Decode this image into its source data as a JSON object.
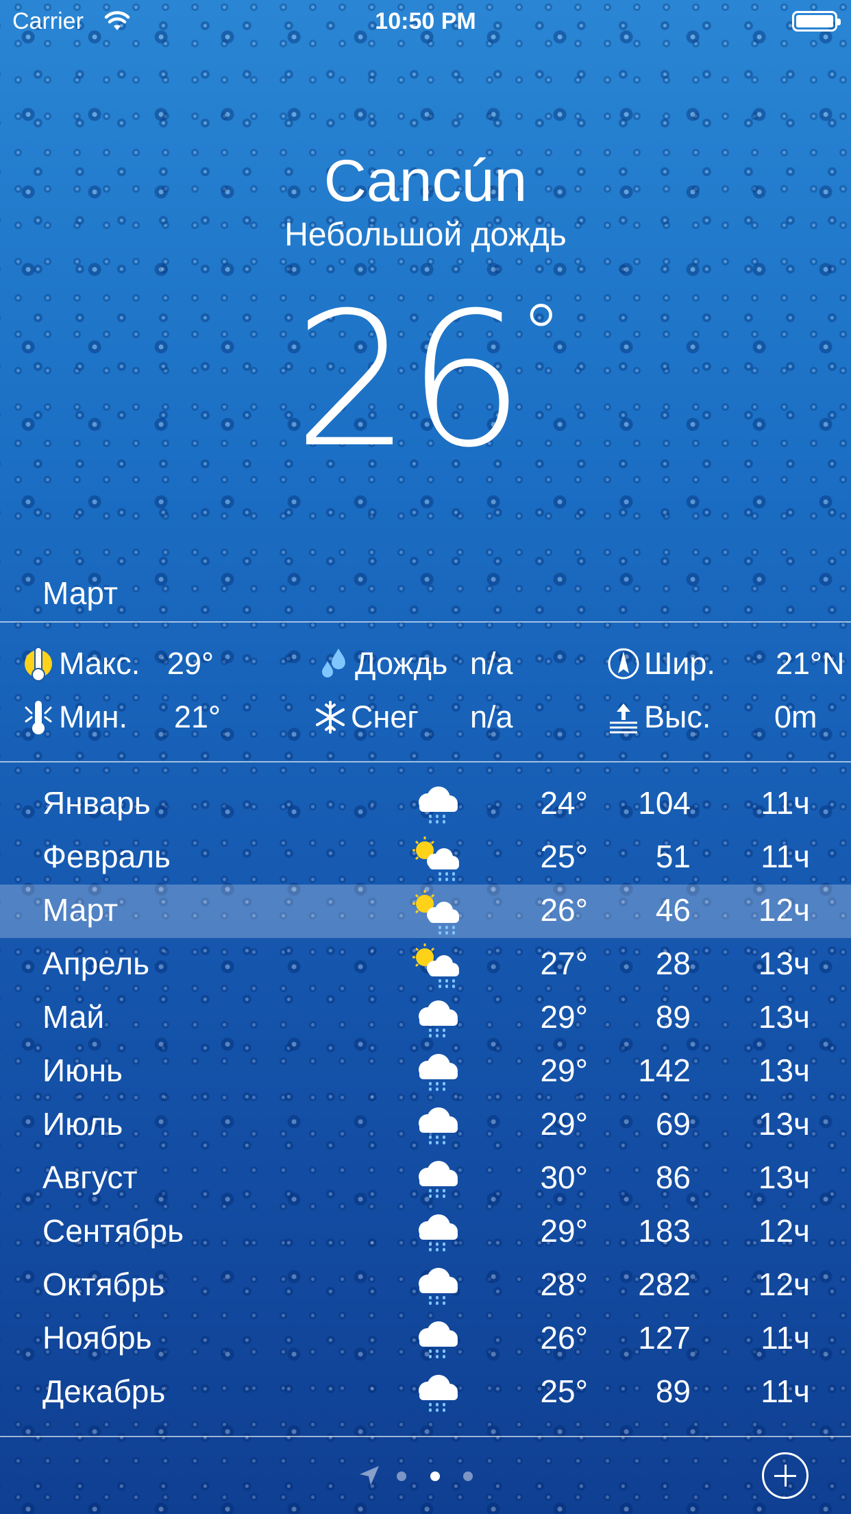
{
  "status_bar": {
    "carrier": "Carrier",
    "time": "10:50 PM"
  },
  "header": {
    "city": "Cancún",
    "condition": "Небольшой дождь",
    "temperature": "26",
    "degree": "°"
  },
  "selected_month": "Март",
  "stats": {
    "max_label": "Макс.",
    "max_value": "29°",
    "min_label": "Мин.",
    "min_value": "21°",
    "rain_label": "Дождь",
    "rain_value": "n/a",
    "snow_label": "Снег",
    "snow_value": "n/a",
    "lat_label": "Шир.",
    "lat_value": "21°N",
    "alt_label": "Выс.",
    "alt_value": "0m"
  },
  "months": [
    {
      "name": "Январь",
      "icon": "cloud-rain-icon",
      "temp": "24°",
      "rain": "104",
      "hours": "11ч"
    },
    {
      "name": "Февраль",
      "icon": "sun-cloud-rain-icon",
      "temp": "25°",
      "rain": "51",
      "hours": "11ч"
    },
    {
      "name": "Март",
      "icon": "sun-cloud-rain-icon",
      "temp": "26°",
      "rain": "46",
      "hours": "12ч"
    },
    {
      "name": "Апрель",
      "icon": "sun-cloud-rain-icon",
      "temp": "27°",
      "rain": "28",
      "hours": "13ч"
    },
    {
      "name": "Май",
      "icon": "cloud-rain-icon",
      "temp": "29°",
      "rain": "89",
      "hours": "13ч"
    },
    {
      "name": "Июнь",
      "icon": "cloud-rain-icon",
      "temp": "29°",
      "rain": "142",
      "hours": "13ч"
    },
    {
      "name": "Июль",
      "icon": "cloud-rain-icon",
      "temp": "29°",
      "rain": "69",
      "hours": "13ч"
    },
    {
      "name": "Август",
      "icon": "cloud-rain-icon",
      "temp": "30°",
      "rain": "86",
      "hours": "13ч"
    },
    {
      "name": "Сентябрь",
      "icon": "cloud-rain-icon",
      "temp": "29°",
      "rain": "183",
      "hours": "12ч"
    },
    {
      "name": "Октябрь",
      "icon": "cloud-rain-icon",
      "temp": "28°",
      "rain": "282",
      "hours": "12ч"
    },
    {
      "name": "Ноябрь",
      "icon": "cloud-rain-icon",
      "temp": "26°",
      "rain": "127",
      "hours": "11ч"
    },
    {
      "name": "Декабрь",
      "icon": "cloud-rain-icon",
      "temp": "25°",
      "rain": "89",
      "hours": "11ч"
    }
  ],
  "selected_index": 2,
  "pager": {
    "page_count": 3,
    "active_page": 2
  },
  "colors": {
    "background_top": "#2a86d4",
    "background_bottom": "#0f3f92",
    "sun": "#ffd21a",
    "rain": "#7fc6ff",
    "cloud": "#ffffff"
  }
}
